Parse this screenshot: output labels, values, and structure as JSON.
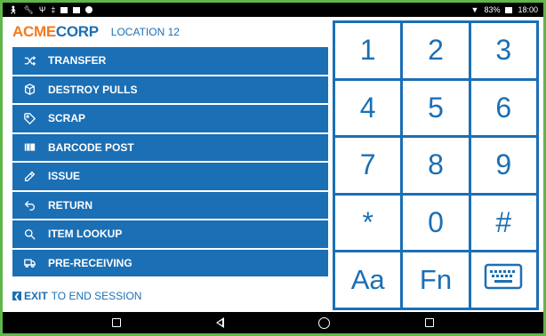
{
  "status_bar": {
    "battery": "83%",
    "time": "18:00"
  },
  "header": {
    "brand_part1": "ACME",
    "brand_part2": "CORP",
    "location": "LOCATION 12"
  },
  "menu": {
    "items": [
      {
        "label": "TRANSFER",
        "icon": "shuffle-icon"
      },
      {
        "label": "DESTROY PULLS",
        "icon": "cube-icon"
      },
      {
        "label": "SCRAP",
        "icon": "tag-icon"
      },
      {
        "label": "BARCODE POST",
        "icon": "barcode-icon"
      },
      {
        "label": "ISSUE",
        "icon": "pencil-icon"
      },
      {
        "label": "RETURN",
        "icon": "return-icon"
      },
      {
        "label": "ITEM LOOKUP",
        "icon": "search-icon"
      },
      {
        "label": "PRE-RECEIVING",
        "icon": "truck-icon"
      }
    ]
  },
  "footer": {
    "exit_label": "EXIT",
    "exit_hint": "TO END SESSION"
  },
  "keypad": {
    "keys": [
      "1",
      "2",
      "3",
      "4",
      "5",
      "6",
      "7",
      "8",
      "9",
      "*",
      "0",
      "#",
      "Aa",
      "Fn"
    ],
    "last_key_icon": "keyboard-icon"
  },
  "colors": {
    "brand_blue": "#1b6fb5",
    "brand_orange": "#f47a1e",
    "frame_green": "#5fb64a"
  }
}
